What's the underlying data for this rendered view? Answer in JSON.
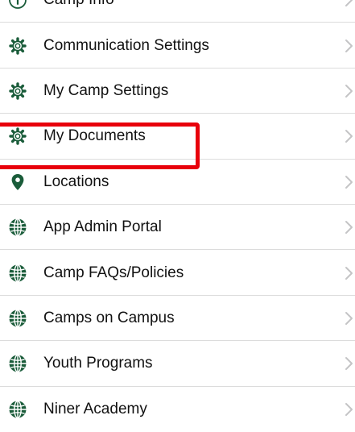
{
  "settings_menu": {
    "accent_color": "#1a5c3a",
    "highlight_color": "#e8000b",
    "items": [
      {
        "label": "Camp Info",
        "icon": "info-icon"
      },
      {
        "label": "Communication Settings",
        "icon": "gear-icon"
      },
      {
        "label": "My Camp Settings",
        "icon": "gear-icon"
      },
      {
        "label": "My Documents",
        "icon": "gear-icon",
        "highlighted": true
      },
      {
        "label": "Locations",
        "icon": "map-pin-icon"
      },
      {
        "label": "App Admin Portal",
        "icon": "globe-icon"
      },
      {
        "label": "Camp FAQs/Policies",
        "icon": "globe-icon"
      },
      {
        "label": "Camps on Campus",
        "icon": "globe-icon"
      },
      {
        "label": "Youth Programs",
        "icon": "globe-icon"
      },
      {
        "label": "Niner Academy",
        "icon": "globe-icon"
      }
    ]
  }
}
